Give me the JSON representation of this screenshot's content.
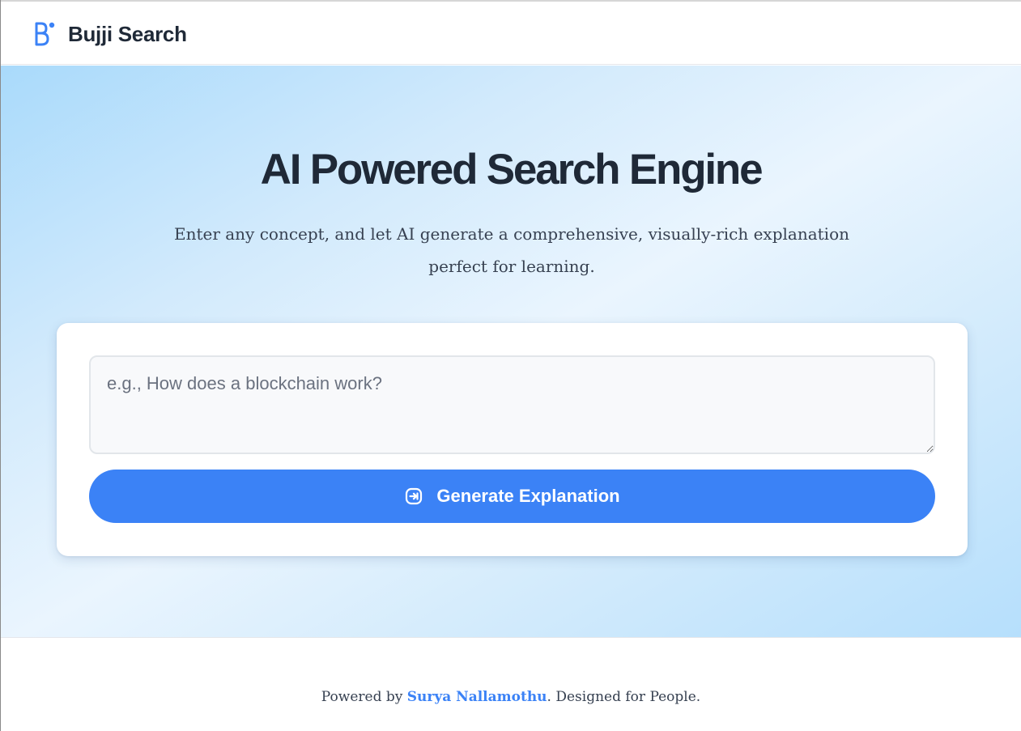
{
  "header": {
    "brand_name": "Bujji Search",
    "logo_icon": "bujji-b-logo"
  },
  "hero": {
    "title": "AI Powered Search Engine",
    "subtitle_line1": "Enter any concept, and let AI generate a comprehensive, visually-rich explanation",
    "subtitle_line2": "perfect for learning."
  },
  "search": {
    "query_value": "",
    "placeholder": "e.g., How does a blockchain work?",
    "button_label": "Generate Explanation",
    "button_icon": "arrow-into-box-icon"
  },
  "footer": {
    "prefix": "Powered by ",
    "author": "Surya Nallamothu",
    "suffix": ". Designed for People."
  },
  "colors": {
    "accent": "#3b82f6",
    "heading": "#1f2937",
    "body_text": "#374151",
    "hero_gradient_edge": "#a9dafb",
    "hero_gradient_center": "#eaf5fe"
  }
}
